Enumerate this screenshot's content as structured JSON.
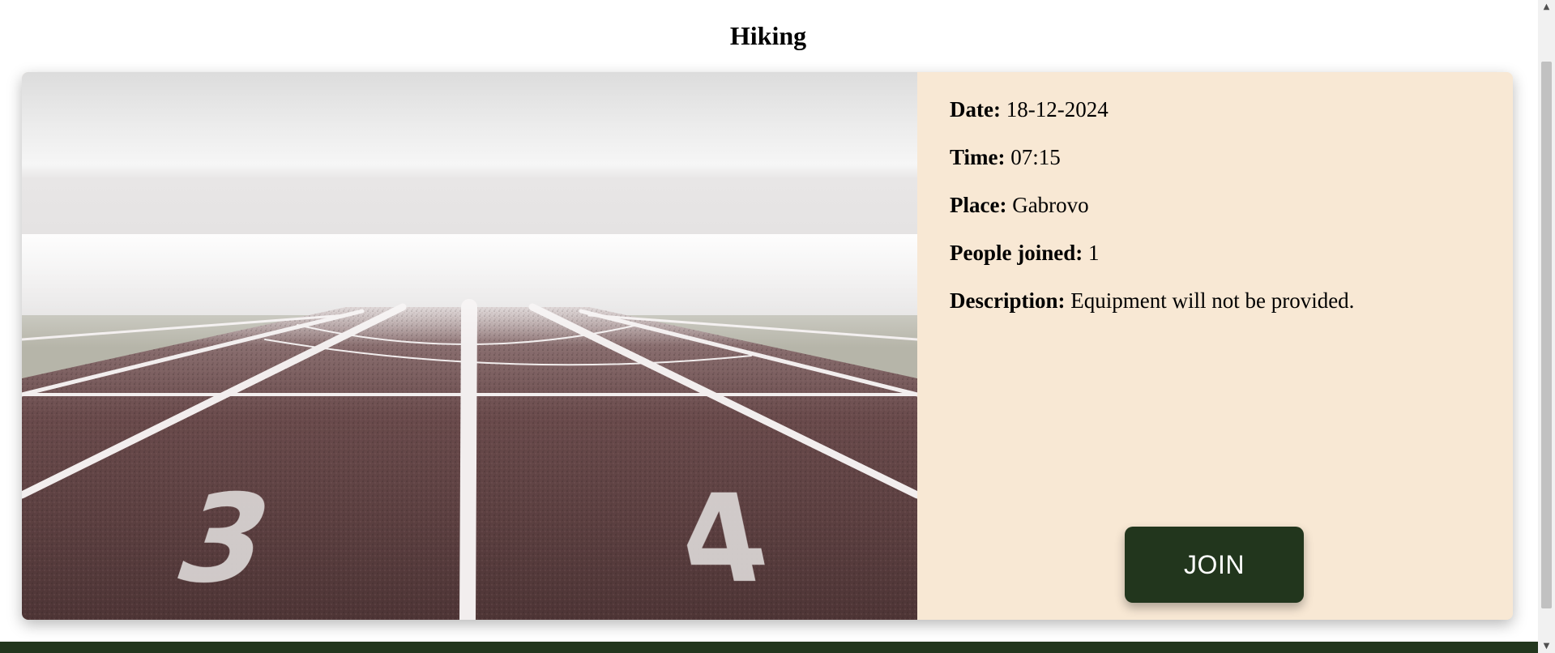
{
  "page": {
    "title": "Hiking"
  },
  "event": {
    "image_alt": "running track with lanes 3 and 4 in fog",
    "details": [
      {
        "label": "Date:",
        "value": "18-12-2024"
      },
      {
        "label": "Time:",
        "value": "07:15"
      },
      {
        "label": "Place:",
        "value": "Gabrovo"
      },
      {
        "label": "People joined:",
        "value": "1"
      },
      {
        "label": "Description:",
        "value": "Equipment will not be provided."
      }
    ],
    "join_label": "JOIN",
    "lane_numbers": [
      "3",
      "4"
    ]
  },
  "colors": {
    "details_background": "#f8e8d4",
    "accent_dark_green": "#22361d",
    "track": "#5a3e3d"
  },
  "scrollbar": {
    "up_icon": "chevron-up-icon",
    "down_icon": "chevron-down-icon"
  }
}
